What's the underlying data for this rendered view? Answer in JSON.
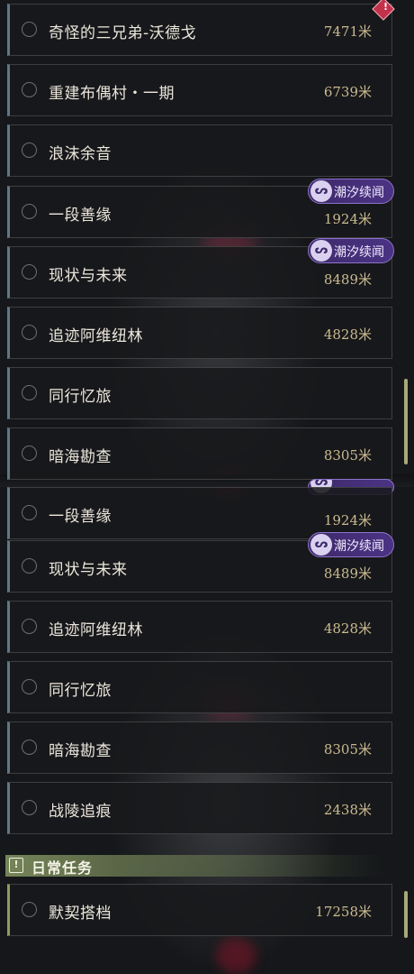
{
  "lists": {
    "top": [
      {
        "title": "奇怪的三兄弟-沃德戈",
        "distance": "7471米"
      },
      {
        "title": "重建布偶村・一期",
        "distance": "6739米"
      },
      {
        "title": "浪沫余音",
        "distance": ""
      },
      {
        "title": "一段善缘",
        "distance": "1924米",
        "tag": "潮汐续闻"
      },
      {
        "title": "现状与未来",
        "distance": "8489米",
        "tag": "潮汐续闻"
      },
      {
        "title": "追迹阿维纽林",
        "distance": "4828米"
      },
      {
        "title": "同行忆旅",
        "distance": ""
      },
      {
        "title": "暗海勘查",
        "distance": "8305米"
      }
    ],
    "bottom": [
      {
        "title": "一段善缘",
        "distance": "1924米",
        "tag": "潮汐续闻"
      },
      {
        "title": "现状与未来",
        "distance": "8489米",
        "tag": "潮汐续闻"
      },
      {
        "title": "追迹阿维纽林",
        "distance": "4828米"
      },
      {
        "title": "同行忆旅",
        "distance": ""
      },
      {
        "title": "暗海勘查",
        "distance": "8305米"
      },
      {
        "title": "战陵追痕",
        "distance": "2438米"
      }
    ],
    "daily_header": "日常任务",
    "daily": [
      {
        "title": "默契搭档",
        "distance": "17258米"
      }
    ]
  },
  "icons": {
    "alert": "alert-diamond-icon",
    "tag": "tide-swirl-icon",
    "daily": "exclamation-box-icon"
  },
  "colors": {
    "tag_bg": "#4b3384",
    "distance": "#c9b98f",
    "daily_accent": "#8f9a5d"
  }
}
